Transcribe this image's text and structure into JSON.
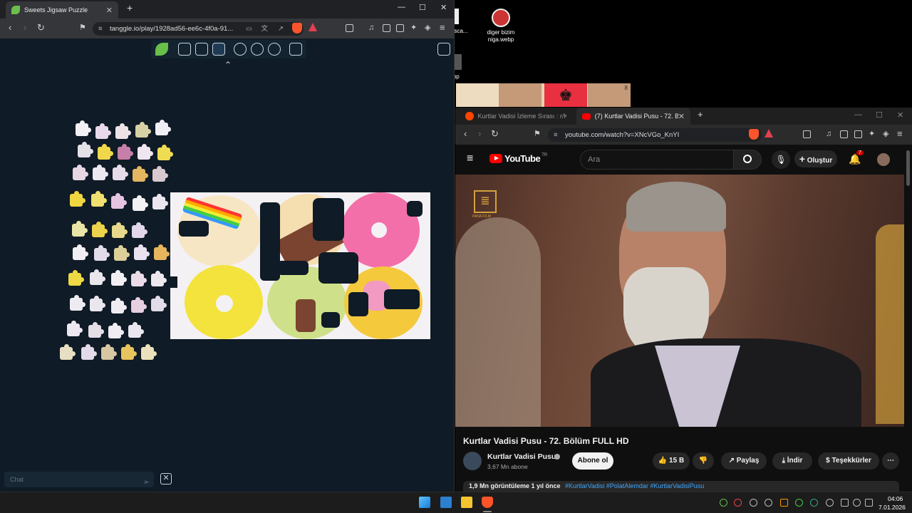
{
  "desktop": {
    "icons": [
      {
        "label": "diger bizim\nniga.webp"
      },
      {
        "label": "sca..."
      },
      {
        "label": "ebp"
      }
    ],
    "thumb_badge": "8"
  },
  "left_browser": {
    "tab_title": "Sweets Jigsaw Puzzle",
    "url": "tanggle.io/play/1928ad56-ee6c-4f0a-91...",
    "chat_placeholder": "Chat",
    "brave_badge": "1"
  },
  "right_browser": {
    "tabs": [
      {
        "title": "Kurtlar Vadisi İzleme Sırası : r/Kurtlar..."
      },
      {
        "title": "(7) Kurtlar Vadisi Pusu - 72. B..."
      }
    ],
    "url": "youtube.com/watch?v=XNcVGo_KnYI",
    "youtube": {
      "logo_text": "YouTube",
      "country": "TR",
      "search_placeholder": "Ara",
      "create_label": "Oluştur",
      "notifications": "7",
      "video_watermark": "PANA FILM",
      "video_title": "Kurtlar Vadisi Pusu - 72. Bölüm FULL HD",
      "channel_name": "Kurtlar Vadisi Pusu",
      "subscribers": "3,67 Mn abone",
      "subscribe_label": "Abone ol",
      "like_count": "15 B",
      "share_label": "Paylaş",
      "download_label": "İndir",
      "thanks_label": "Teşekkürler",
      "description": "1,9 Mn görüntüleme  1 yıl önce",
      "hashtags": "#KurtlarVadisi #PolatAlemdar #KurtlarVadisiPusu"
    }
  },
  "taskbar": {
    "time": "04:06",
    "date": "7.01.2026"
  },
  "colors": {
    "tanggle_bg": "#0f1b26",
    "youtube_red": "#ff0000",
    "brave_orange": "#fb542b"
  }
}
